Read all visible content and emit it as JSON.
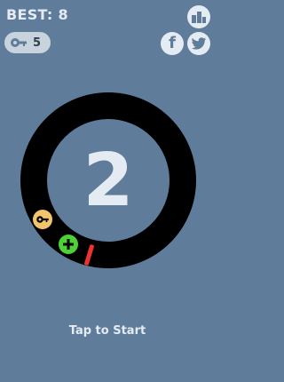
{
  "header": {
    "best_label": "BEST: 8"
  },
  "keys": {
    "count": "5",
    "icon": "key-icon"
  },
  "buttons": {
    "leaderboard_icon": "leaderboard-icon",
    "facebook_label": "f",
    "twitter_icon": "twitter-icon"
  },
  "game": {
    "score": "2",
    "tokens": [
      "key-token",
      "plus-token"
    ],
    "player": "red-bar"
  },
  "prompt": {
    "tap_label": "Tap to Start"
  },
  "colors": {
    "background": "#5f7d9b",
    "ring": "#000000",
    "key_token": "#f2c46d",
    "plus_token": "#4cd137",
    "player": "#f0322d"
  }
}
